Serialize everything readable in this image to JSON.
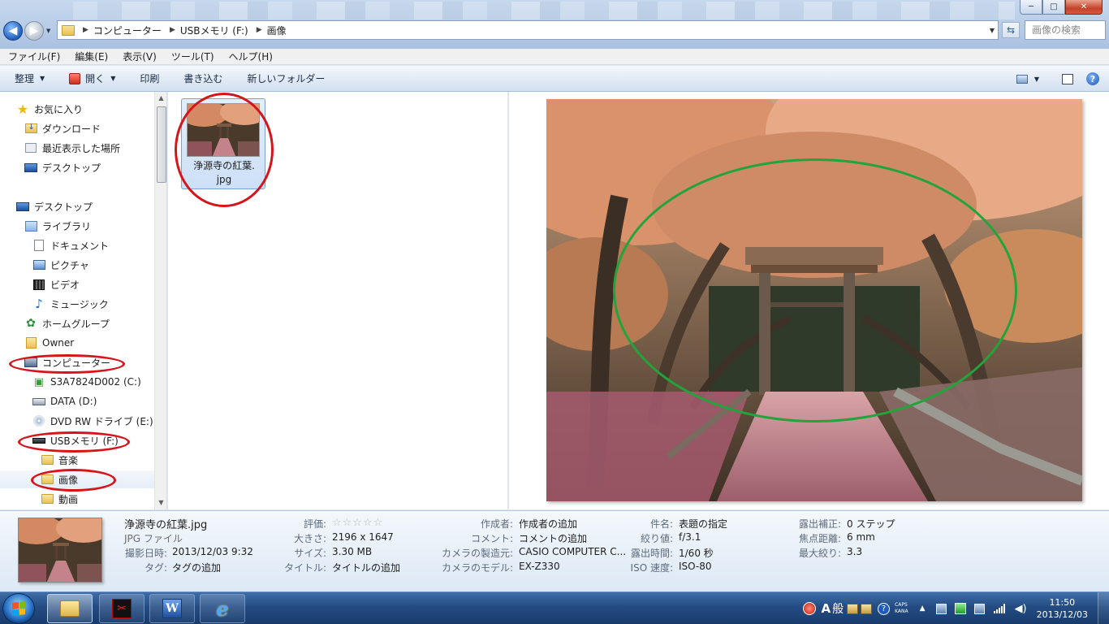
{
  "window": {
    "minimize": "─",
    "maximize": "□",
    "close": "✕"
  },
  "address": {
    "crumbs": [
      "コンピューター",
      "USBメモリ (F:)",
      "画像"
    ],
    "search_placeholder": "画像の検索"
  },
  "menu": [
    "ファイル(F)",
    "編集(E)",
    "表示(V)",
    "ツール(T)",
    "ヘルプ(H)"
  ],
  "commands": {
    "organize": "整理",
    "open": "開く",
    "print": "印刷",
    "burn": "書き込む",
    "new_folder": "新しいフォルダー",
    "help": "?"
  },
  "nav": {
    "favorites": "お気に入り",
    "downloads": "ダウンロード",
    "recent": "最近表示した場所",
    "desktop_fav": "デスクトップ",
    "desktop": "デスクトップ",
    "libraries": "ライブラリ",
    "documents": "ドキュメント",
    "pictures": "ピクチャ",
    "videos": "ビデオ",
    "music": "ミュージック",
    "homegroup": "ホームグループ",
    "owner": "Owner",
    "computer": "コンピューター",
    "drive_c": "S3A7824D002 (C:)",
    "drive_d": "DATA (D:)",
    "drive_e": "DVD RW ドライブ (E:)",
    "drive_f": "USBメモリ (F:)",
    "folder_music": "音楽",
    "folder_images": "画像",
    "folder_videos": "動画"
  },
  "file": {
    "name": "浄源寺の紅葉.jpg",
    "label": "浄源寺の紅葉.\njpg"
  },
  "details": {
    "name": "浄源寺の紅葉.jpg",
    "type": "JPG ファイル",
    "fields": {
      "date_taken_label": "撮影日時:",
      "date_taken": "2013/12/03 9:32",
      "tags_label": "タグ:",
      "tags": "タグの追加",
      "rating_label": "評価:",
      "dimensions_label": "大きさ:",
      "dimensions": "2196 x 1647",
      "size_label": "サイズ:",
      "size": "3.30 MB",
      "title_label": "タイトル:",
      "title": "タイトルの追加",
      "authors_label": "作成者:",
      "authors": "作成者の追加",
      "comments_label": "コメント:",
      "comments": "コメントの追加",
      "camera_maker_label": "カメラの製造元:",
      "camera_maker": "CASIO COMPUTER C...",
      "camera_model_label": "カメラのモデル:",
      "camera_model": "EX-Z330",
      "subject_label": "件名:",
      "subject": "表題の指定",
      "fstop_label": "絞り値:",
      "fstop": "f/3.1",
      "exposure_label": "露出時間:",
      "exposure": "1/60 秒",
      "iso_label": "ISO 速度:",
      "iso": "ISO-80",
      "exp_bias_label": "露出補正:",
      "exp_bias": "0 ステップ",
      "focal_label": "焦点距離:",
      "focal": "6 mm",
      "max_aperture_label": "最大絞り:",
      "max_aperture": "3.3"
    },
    "rating_stars": "☆☆☆☆☆"
  },
  "taskbar": {
    "ime_mode": "A",
    "ime_dict": "般",
    "caps": "CAPS",
    "kana": "KANA",
    "time": "11:50",
    "date": "2013/12/03"
  },
  "colors": {
    "annotation_red": "#d8141b",
    "annotation_green": "#22a43b"
  }
}
